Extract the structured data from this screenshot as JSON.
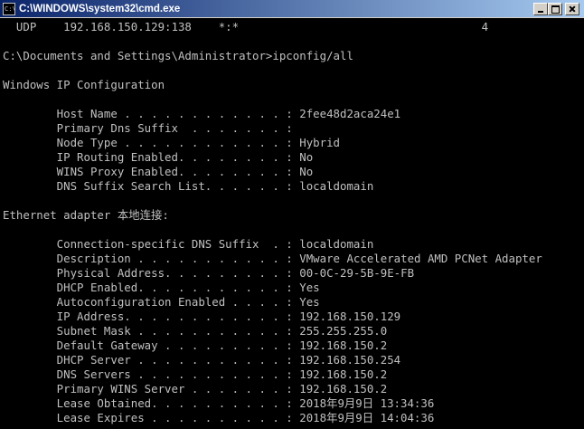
{
  "window": {
    "title": "C:\\WINDOWS\\system32\\cmd.exe",
    "icon": "cmd-icon",
    "buttons": [
      "minimize-icon",
      "maximize-icon",
      "close-icon"
    ]
  },
  "console": {
    "colors": {
      "background": "#000000",
      "text": "#c0c0c0",
      "titlebar": "#0a246a"
    },
    "lines": [
      "  UDP    192.168.150.129:138    *:*                                    4",
      "",
      "C:\\Documents and Settings\\Administrator>ipconfig/all",
      "",
      "Windows IP Configuration",
      "",
      "        Host Name . . . . . . . . . . . . : 2fee48d2aca24e1",
      "        Primary Dns Suffix  . . . . . . . :",
      "        Node Type . . . . . . . . . . . . : Hybrid",
      "        IP Routing Enabled. . . . . . . . : No",
      "        WINS Proxy Enabled. . . . . . . . : No",
      "        DNS Suffix Search List. . . . . . : localdomain",
      "",
      "Ethernet adapter 本地连接:",
      "",
      "        Connection-specific DNS Suffix  . : localdomain",
      "        Description . . . . . . . . . . . : VMware Accelerated AMD PCNet Adapter",
      "        Physical Address. . . . . . . . . : 00-0C-29-5B-9E-FB",
      "        DHCP Enabled. . . . . . . . . . . : Yes",
      "        Autoconfiguration Enabled . . . . : Yes",
      "        IP Address. . . . . . . . . . . . : 192.168.150.129",
      "        Subnet Mask . . . . . . . . . . . : 255.255.255.0",
      "        Default Gateway . . . . . . . . . : 192.168.150.2",
      "        DHCP Server . . . . . . . . . . . : 192.168.150.254",
      "        DNS Servers . . . . . . . . . . . : 192.168.150.2",
      "        Primary WINS Server . . . . . . . : 192.168.150.2",
      "        Lease Obtained. . . . . . . . . . : 2018年9月9日 13:34:36",
      "        Lease Expires . . . . . . . . . . : 2018年9月9日 14:04:36"
    ]
  }
}
